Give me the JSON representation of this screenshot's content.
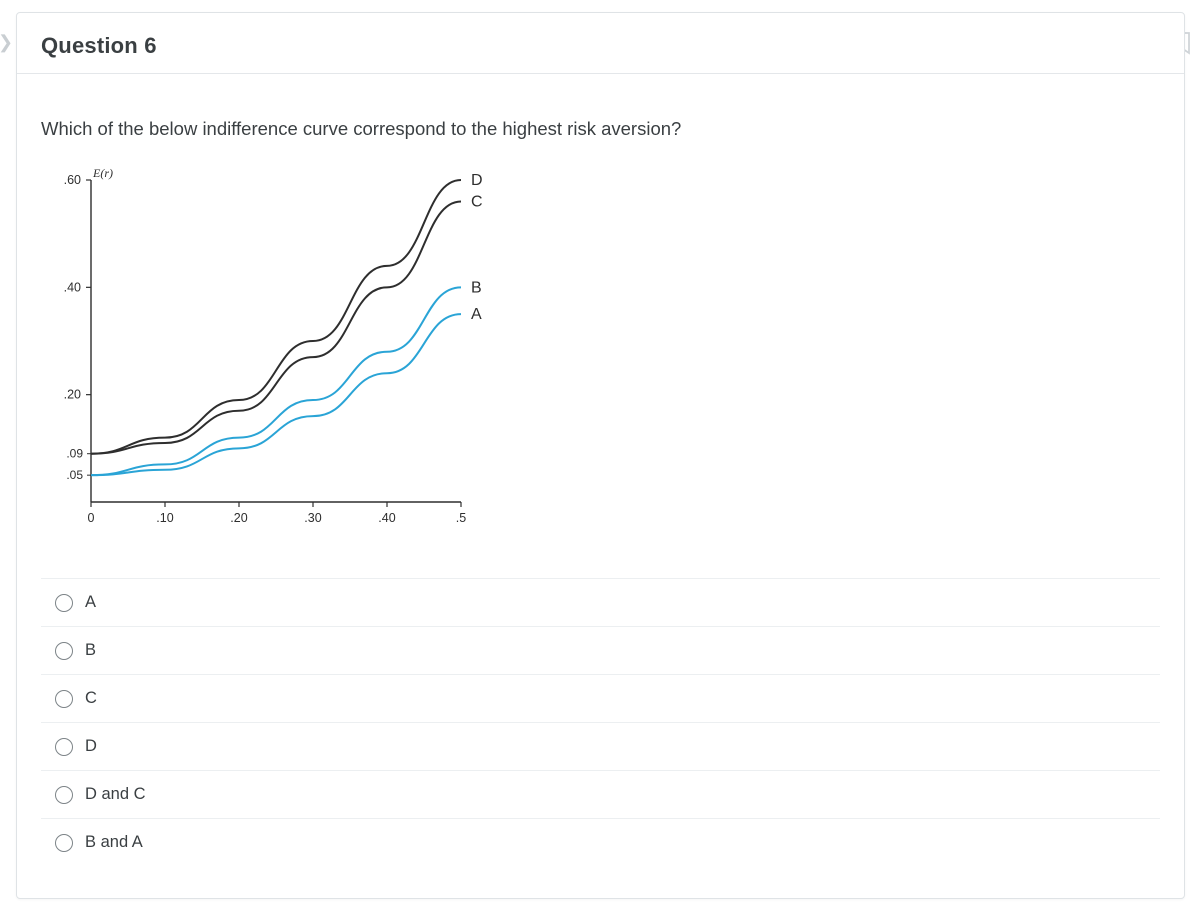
{
  "question": {
    "title": "Question 6",
    "prompt": "Which of the below indifference curve correspond to the highest risk aversion?"
  },
  "options": [
    {
      "label": "A"
    },
    {
      "label": "B"
    },
    {
      "label": "C"
    },
    {
      "label": "D"
    },
    {
      "label": "D and C"
    },
    {
      "label": "B and A"
    }
  ],
  "chart_data": {
    "type": "line",
    "title": "",
    "xlabel": "",
    "ylabel": "E(r)",
    "xlim": [
      0,
      0.5
    ],
    "ylim": [
      0,
      0.6
    ],
    "xticks": [
      0,
      0.1,
      0.2,
      0.3,
      0.4,
      0.5
    ],
    "yticks_major": [
      0.2,
      0.4,
      0.6
    ],
    "yticks_minor": [
      0.05,
      0.09
    ],
    "xtick_labels": [
      "0",
      ".10",
      ".20",
      ".30",
      ".40",
      ".5"
    ],
    "ytick_labels": [
      ".20",
      ".40",
      ".60"
    ],
    "ytick_minor_labels": [
      ".05",
      ".09"
    ],
    "series": [
      {
        "name": "A",
        "color": "#2aa4d6",
        "x": [
          0,
          0.1,
          0.2,
          0.3,
          0.4,
          0.5
        ],
        "values": [
          0.05,
          0.06,
          0.1,
          0.16,
          0.24,
          0.35
        ]
      },
      {
        "name": "B",
        "color": "#2aa4d6",
        "x": [
          0,
          0.1,
          0.2,
          0.3,
          0.4,
          0.5
        ],
        "values": [
          0.05,
          0.07,
          0.12,
          0.19,
          0.28,
          0.4
        ]
      },
      {
        "name": "C",
        "color": "#2e2e2e",
        "x": [
          0,
          0.1,
          0.2,
          0.3,
          0.4,
          0.5
        ],
        "values": [
          0.09,
          0.11,
          0.17,
          0.27,
          0.4,
          0.56
        ]
      },
      {
        "name": "D",
        "color": "#2e2e2e",
        "x": [
          0,
          0.1,
          0.2,
          0.3,
          0.4,
          0.5
        ],
        "values": [
          0.09,
          0.12,
          0.19,
          0.3,
          0.44,
          0.6
        ]
      }
    ],
    "line_labels": {
      "D": "D",
      "C": "C",
      "B": "B",
      "A": "A"
    }
  }
}
